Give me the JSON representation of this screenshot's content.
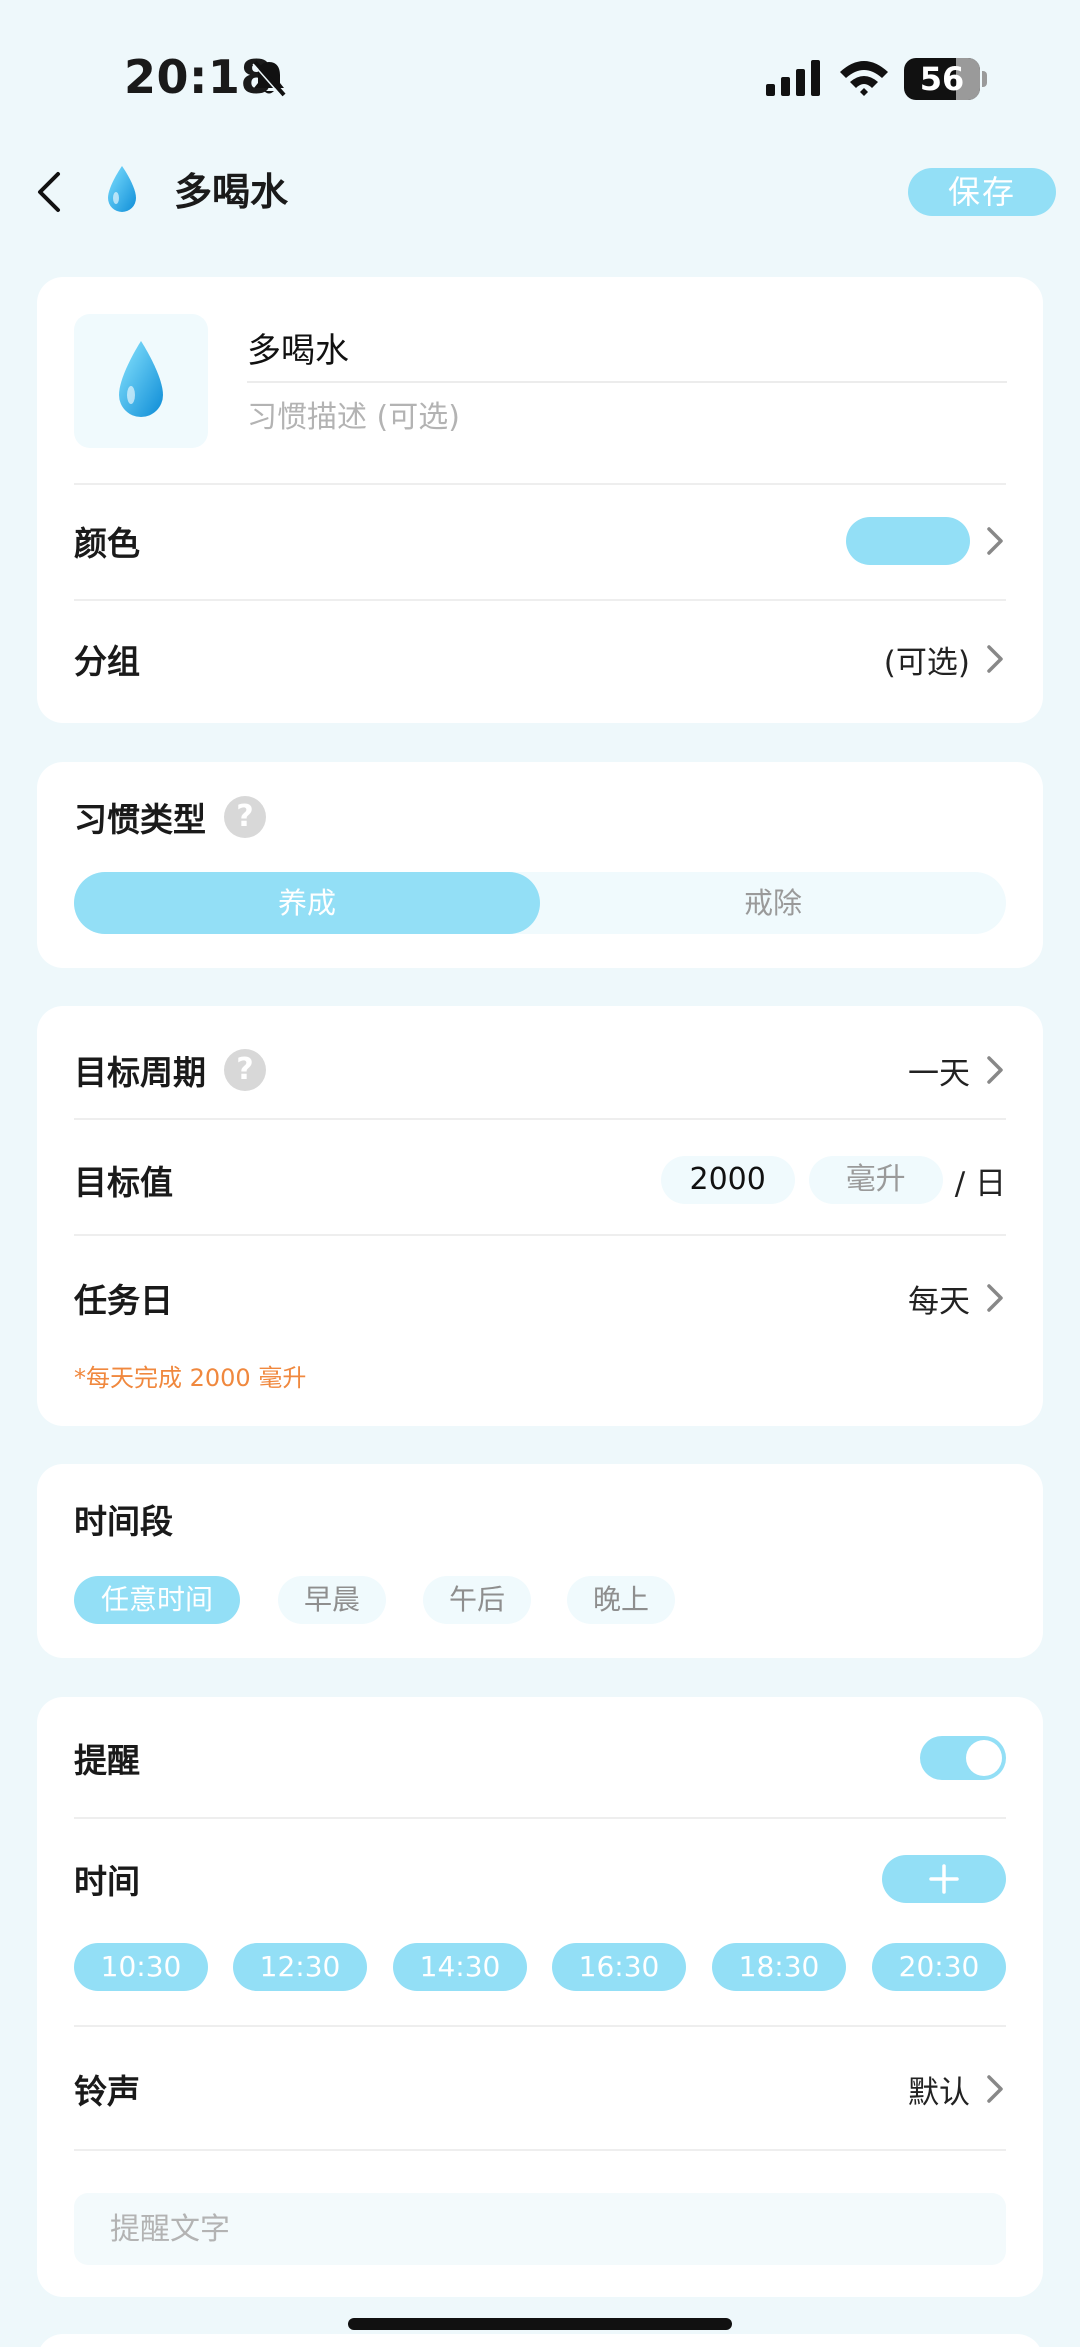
{
  "status_bar": {
    "time": "20:18",
    "battery": "56",
    "icons": [
      "bell-slash-icon",
      "signal-icon",
      "wifi-icon",
      "battery-icon"
    ]
  },
  "nav": {
    "title": "多喝水",
    "icon": "water-drop-icon",
    "save_label": "保存"
  },
  "habit": {
    "name": "多喝水",
    "description_placeholder": "习惯描述 (可选)",
    "color_label": "颜色",
    "color_value": "#93dff6",
    "group_label": "分组",
    "group_value": "(可选)"
  },
  "habit_type": {
    "label": "习惯类型",
    "options": [
      "养成",
      "戒除"
    ],
    "selected": "养成"
  },
  "goal": {
    "period_label": "目标周期",
    "period_value": "一天",
    "target_label": "目标值",
    "target_value": "2000",
    "target_unit": "毫升",
    "target_per": "/ 日",
    "days_label": "任务日",
    "days_value": "每天",
    "hint": "*每天完成 2000 毫升"
  },
  "time_period": {
    "label": "时间段",
    "options": [
      "任意时间",
      "早晨",
      "午后",
      "晚上"
    ],
    "selected": "任意时间"
  },
  "reminder": {
    "label": "提醒",
    "enabled": true,
    "time_label": "时间",
    "times": [
      "10:30",
      "12:30",
      "14:30",
      "16:30",
      "18:30",
      "20:30"
    ],
    "sound_label": "铃声",
    "sound_value": "默认",
    "text_placeholder": "提醒文字"
  },
  "colors": {
    "accent": "#93dff6",
    "background": "#eef8fb",
    "hint": "#f0883e"
  }
}
